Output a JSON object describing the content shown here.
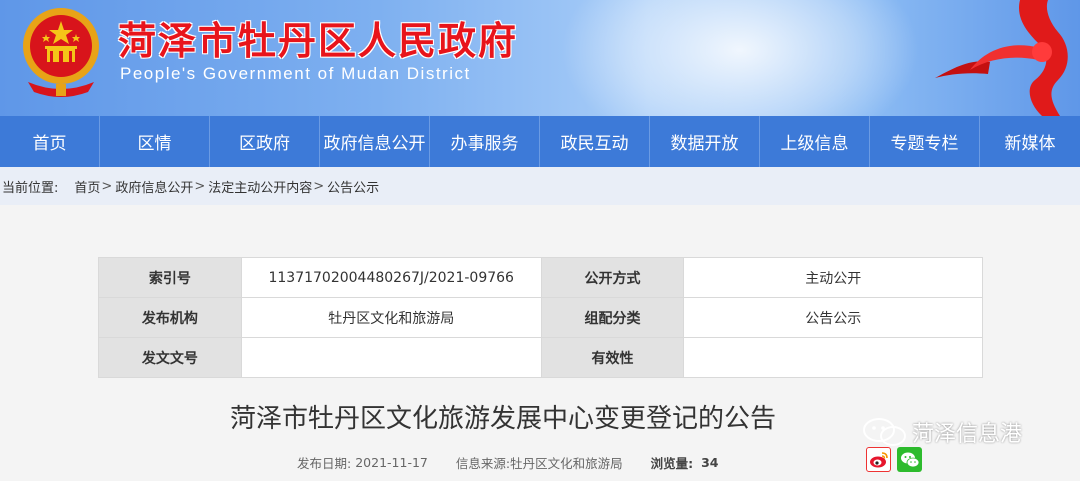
{
  "header": {
    "title_cn": "菏泽市牡丹区人民政府",
    "title_en": "People's Government of Mudan District"
  },
  "nav": {
    "items": [
      "首页",
      "区情",
      "区政府",
      "政府信息公开",
      "办事服务",
      "政民互动",
      "数据开放",
      "上级信息",
      "专题专栏",
      "新媒体"
    ]
  },
  "breadcrumb": {
    "label": "当前位置:",
    "items": [
      "首页",
      "政府信息公开",
      "法定主动公开内容",
      "公告公示"
    ],
    "separator": ">"
  },
  "meta": {
    "index_label": "索引号",
    "index_value": "11371702004480267J/2021-09766",
    "method_label": "公开方式",
    "method_value": "主动公开",
    "org_label": "发布机构",
    "org_value": "牡丹区文化和旅游局",
    "category_label": "组配分类",
    "category_value": "公告公示",
    "docno_label": "发文文号",
    "docno_value": "",
    "validity_label": "有效性",
    "validity_value": ""
  },
  "article": {
    "title": "菏泽市牡丹区文化旅游发展中心变更登记的公告",
    "date_label": "发布日期:",
    "date_value": "2021-11-17",
    "source_label": "信息来源:",
    "source_value": "牡丹区文化和旅游局",
    "views_label": "浏览量:",
    "views_value": "34"
  },
  "watermark": {
    "text": "菏泽信息港"
  },
  "icons": {
    "emblem": "national-emblem-icon",
    "weibo": "weibo-icon",
    "wechat": "wechat-icon"
  },
  "colors": {
    "nav_bg": "#3d7ad8",
    "title_red": "#e8141b",
    "breadcrumb_bg": "#e9eef7"
  }
}
